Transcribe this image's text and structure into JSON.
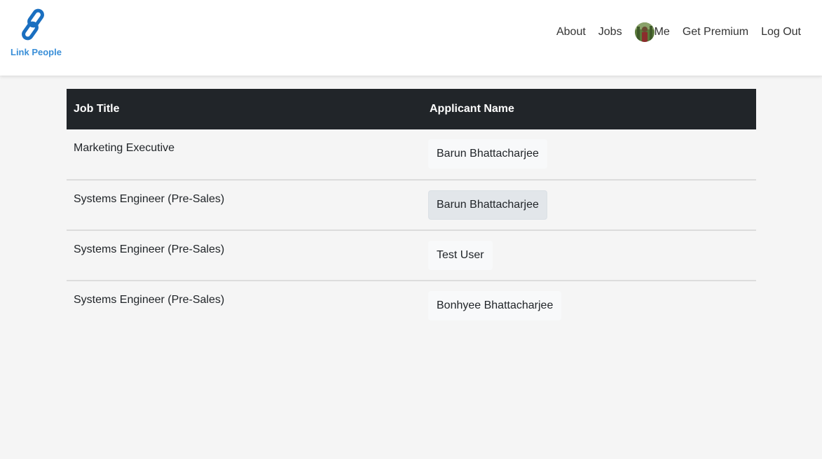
{
  "brand": {
    "name": "Link People",
    "icon": "chain-link-icon",
    "color": "#3a8fd8"
  },
  "nav": {
    "items": [
      {
        "label": "About"
      },
      {
        "label": "Jobs"
      },
      {
        "label": "Me",
        "icon": "avatar"
      },
      {
        "label": "Get Premium"
      },
      {
        "label": "Log Out"
      }
    ]
  },
  "table": {
    "headers": {
      "job_title": "Job Title",
      "applicant_name": "Applicant Name"
    },
    "rows": [
      {
        "job_title": "Marketing Executive",
        "applicant": "Barun Bhattacharjee",
        "highlighted": false
      },
      {
        "job_title": "Systems Engineer (Pre-Sales)",
        "applicant": "Barun Bhattacharjee",
        "highlighted": true
      },
      {
        "job_title": "Systems Engineer (Pre-Sales)",
        "applicant": "Test User",
        "highlighted": false
      },
      {
        "job_title": "Systems Engineer (Pre-Sales)",
        "applicant": "Bonhyee Bhattacharjee",
        "highlighted": false
      }
    ]
  },
  "colors": {
    "header_bg": "#212529",
    "page_bg": "#f5f5f5",
    "link_blue": "#3a8fd8"
  }
}
